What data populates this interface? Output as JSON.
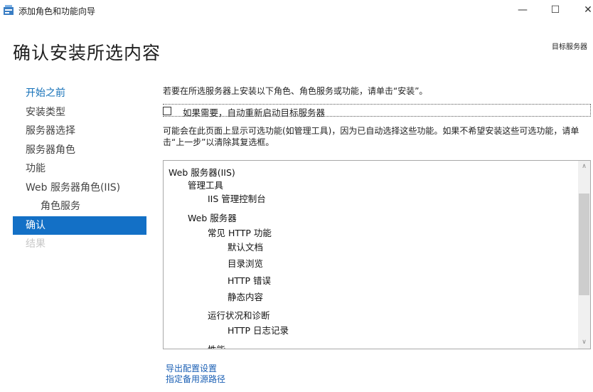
{
  "window": {
    "title": "添加角色和功能向导",
    "minimize_glyph": "—",
    "maximize_glyph": "☐",
    "close_glyph": "✕"
  },
  "header": {
    "page_title": "确认安装所选内容",
    "destination_label": "目标服务器"
  },
  "nav": {
    "items": [
      {
        "label": "开始之前",
        "state": "link"
      },
      {
        "label": "安装类型",
        "state": "normal"
      },
      {
        "label": "服务器选择",
        "state": "normal"
      },
      {
        "label": "服务器角色",
        "state": "normal"
      },
      {
        "label": "功能",
        "state": "normal"
      },
      {
        "label": "Web 服务器角色(IIS)",
        "state": "normal"
      },
      {
        "label": "角色服务",
        "state": "normal"
      },
      {
        "label": "确认",
        "state": "active"
      },
      {
        "label": "结果",
        "state": "disabled"
      }
    ]
  },
  "main": {
    "intro": "若要在所选服务器上安装以下角色、角色服务或功能，请单击“安装”。",
    "restart_checkbox_label": "如果需要，自动重新启动目标服务器",
    "restart_checked": false,
    "note": "可能会在此页面上显示可选功能(如管理工具)，因为已自动选择这些功能。如果不希望安装这些可选功能，请单击“上一步”以清除其复选框。",
    "tree": [
      {
        "label": "Web 服务器(IIS)",
        "level": 0
      },
      {
        "label": "管理工具",
        "level": 1
      },
      {
        "label": "IIS 管理控制台",
        "level": 2
      },
      {
        "label": "Web 服务器",
        "level": 1
      },
      {
        "label": "常见 HTTP 功能",
        "level": 2
      },
      {
        "label": "默认文档",
        "level": 3
      },
      {
        "label": "目录浏览",
        "level": 3
      },
      {
        "label": "HTTP 错误",
        "level": 3
      },
      {
        "label": "静态内容",
        "level": 3
      },
      {
        "label": "运行状况和诊断",
        "level": 2
      },
      {
        "label": "HTTP 日志记录",
        "level": 3
      },
      {
        "label": "性能",
        "level": 2
      }
    ],
    "links": {
      "export": "导出配置设置",
      "alternate_source": "指定备用源路径"
    }
  },
  "colors": {
    "accent": "#1370c6",
    "link": "#1470b8"
  }
}
